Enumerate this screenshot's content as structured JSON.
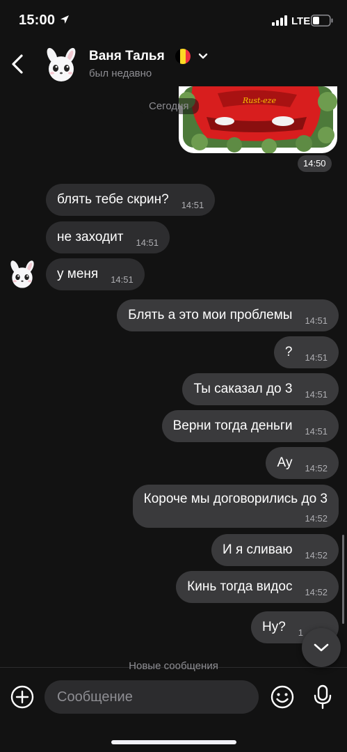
{
  "status_bar": {
    "time": "15:00",
    "network": "LTE",
    "icons": [
      "location-arrow-icon",
      "signal-bars-icon",
      "battery-icon"
    ]
  },
  "header": {
    "contact_name": "Ваня Талья",
    "last_seen": "был недавно",
    "icons": [
      "back-arrow-icon",
      "avatar-bunny",
      "belgium-flag-icon",
      "chevron-down-icon"
    ]
  },
  "chat": {
    "date_divider": "Сегодня",
    "sticker_time": "14:50",
    "messages": [
      {
        "side": "in",
        "text": "блять тебе скрин?",
        "time": "14:51"
      },
      {
        "side": "in",
        "text": "не заходит",
        "time": "14:51"
      },
      {
        "side": "in",
        "text": "у меня",
        "time": "14:51"
      },
      {
        "side": "out",
        "text": "Блять а это мои проблемы",
        "time": "14:51"
      },
      {
        "side": "out",
        "text": "?",
        "time": "14:51"
      },
      {
        "side": "out",
        "text": "Ты саказал до 3",
        "time": "14:51"
      },
      {
        "side": "out",
        "text": "Верни тогда деньги",
        "time": "14:51"
      },
      {
        "side": "out",
        "text": "Ау",
        "time": "14:52"
      },
      {
        "side": "out",
        "text": "Короче мы договорились до 3",
        "time": "14:52"
      },
      {
        "side": "out",
        "text": "И я сливаю",
        "time": "14:52"
      },
      {
        "side": "out",
        "text": "Кинь тогда видос",
        "time": "14:52"
      },
      {
        "side": "out",
        "text": "Ну?",
        "time": "1"
      }
    ],
    "new_messages_label": "Новые сообщения"
  },
  "input_bar": {
    "placeholder": "Сообщение",
    "icons": [
      "plus-circle-icon",
      "emoji-icon",
      "microphone-icon"
    ]
  },
  "colors": {
    "background": "#121212",
    "incoming_bubble": "#2d2d2f",
    "outgoing_bubble": "#3a3a3c",
    "secondary_text": "#8e8e93",
    "flag_black": "#000000",
    "flag_yellow": "#FDDA24",
    "flag_red": "#EF3340"
  }
}
